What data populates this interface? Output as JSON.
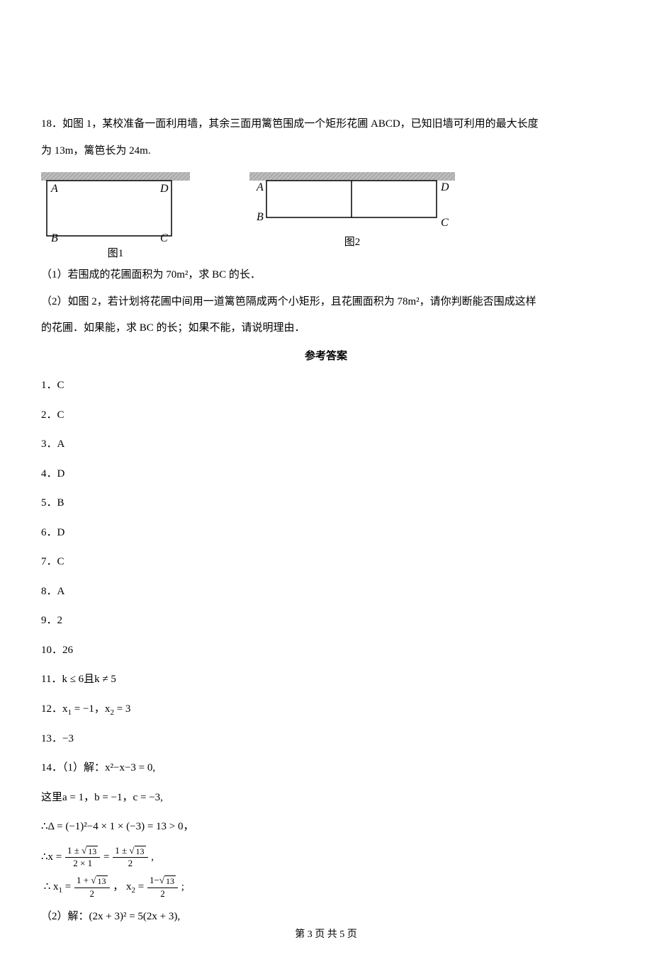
{
  "q18": {
    "stem_line1": "18．如图 1，某校准备一面利用墙，其余三面用篱笆围成一个矩形花圃 ABCD，已知旧墙可利用的最大长度",
    "stem_line2": "为 13m，篱笆长为 24m.",
    "fig1_label": "图1",
    "fig2_label": "图2",
    "A": "A",
    "B": "B",
    "C": "C",
    "D": "D",
    "part1": "（1）若围成的花圃面积为 70m²，求 BC 的长．",
    "part2": "（2）如图 2，若计划将花圃中间用一道篱笆隔成两个小矩形，且花圃面积为 78m²，请你判断能否围成这样",
    "part2b": "的花圃．如果能，求 BC 的长；如果不能，请说明理由．"
  },
  "answers_title": "参考答案",
  "answers_simple": {
    "a1": "1．C",
    "a2": "2．C",
    "a3": "3．A",
    "a4": "4．D",
    "a5": "5．B",
    "a6": "6．D",
    "a7": "7．C",
    "a8": "8．A",
    "a9": "9．2",
    "a10": "10．26",
    "a11": "11．k ≤ 6且k ≠ 5",
    "a13": "13．−3"
  },
  "a12": {
    "prefix": "12．x",
    "sub1": "1",
    "eqm1": " = −1，x",
    "sub2": "2",
    "eq3": " = 3"
  },
  "a14": {
    "l1": "14．（1）解：x²−x−3 = 0,",
    "l2": "这里a = 1，b = −1，c = −3,",
    "l3_prefix": "∴Δ = (−1)²−4 × 1 × (−3) = 13 > 0，",
    "l4_prefix": "∴x =",
    "frac1_num": "1 ± √13",
    "frac1_den": "2 × 1",
    "equals": " = ",
    "frac2_num": "1 ± √13",
    "frac2_den": "2",
    "comma": ",",
    "l5_therefore": "∴  x",
    "sub1": "1",
    "eq": " = ",
    "frac3_num": "1 + √13",
    "frac3_den": "2",
    "sep": "， x",
    "sub2": "2",
    "frac4_num": "1−√13",
    "frac4_den": "2",
    "semi": ";",
    "l6": "（2）解：(2x + 3)² = 5(2x + 3),"
  },
  "sqrt13": "13",
  "footer": {
    "page": "第 3 页 共 5 页"
  }
}
